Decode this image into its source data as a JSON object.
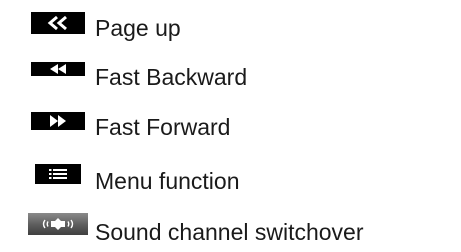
{
  "items": [
    {
      "icon": "page-up-icon",
      "label": "Page up"
    },
    {
      "icon": "fast-backward-icon",
      "label": "Fast Backward"
    },
    {
      "icon": "fast-forward-icon",
      "label": "Fast Forward"
    },
    {
      "icon": "menu-icon",
      "label": "Menu function"
    },
    {
      "icon": "sound-channel-icon",
      "label": "Sound channel switchover"
    }
  ]
}
